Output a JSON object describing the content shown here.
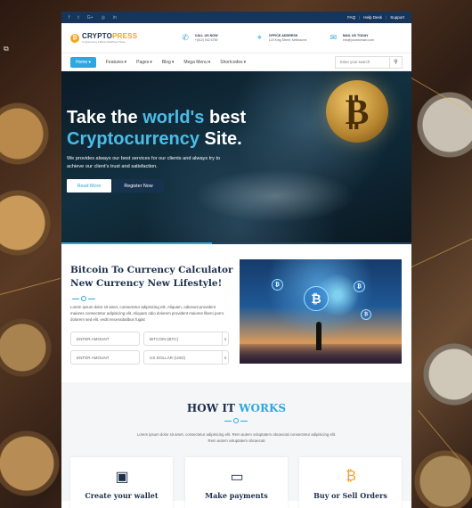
{
  "social": [
    "f",
    "t",
    "G+",
    "◎",
    "in"
  ],
  "toplinks": {
    "faq": "FAQ",
    "help": "Help Desk",
    "support": "Support"
  },
  "logo": {
    "brand_a": "CRYPTO",
    "brand_b": "PRESS",
    "tagline": "Cryptocurrency & Bitcoin WordPress Theme"
  },
  "contacts": [
    {
      "title": "CALL US NOW",
      "value": "+(012) 542 6789",
      "icon": "phone-icon"
    },
    {
      "title": "OFFICE ADDRESS",
      "value": "123 King Street, Melbourne",
      "icon": "map-marker-icon"
    },
    {
      "title": "MAIL US TODAY",
      "value": "info@yourdomain.com",
      "icon": "envelope-icon"
    }
  ],
  "nav": [
    {
      "label": "Home",
      "active": true
    },
    {
      "label": "Features",
      "active": false
    },
    {
      "label": "Pages",
      "active": false
    },
    {
      "label": "Blog",
      "active": false
    },
    {
      "label": "Mega Menu",
      "active": false
    },
    {
      "label": "Shortcodes",
      "active": false
    }
  ],
  "search": {
    "placeholder": "Enter your search"
  },
  "hero": {
    "line1_a": "Take the ",
    "line1_b": "world's",
    "line1_c": " best",
    "line2_a": "Cryptocurrency",
    "line2_b": " Site.",
    "paragraph": "We provides always our best services for our clients and always try to achieve our client's trust and satisfaction.",
    "btn_read": "Read More",
    "btn_register": "Register Now",
    "slide_progress": 0.43
  },
  "calculator": {
    "heading1": "Bitcoin To Currency Calculator",
    "heading2": "New Currency New Lifestyle!",
    "paragraph": "Lorem ipsum dolor sit amet, consectetur adipisicing elit. Aliquam, odiosunt provident maiores consectetur adipisicing elit. Aliquam odio dolorem provident maiores libero porro dolorem sed elit. vedit necessitatibus fugiat",
    "amount_placeholder": "ENTER AMOUNT",
    "currency1": "BITCOIN (BTC)",
    "currency2": "US DOLLAR (USD)"
  },
  "how": {
    "title_a": "HOW IT ",
    "title_b": "WORKS",
    "paragraph": "Lorem ipsum dolor sit amet, consectetur adipisicing elit. Rem autem voluptatem obcaecati consectetur adipisicing elit. Rem autem voluptatem obcaecati",
    "cards": [
      {
        "title": "Create your wallet",
        "icon": "wallet-icon"
      },
      {
        "title": "Make payments",
        "icon": "credit-card-icon"
      },
      {
        "title": "Buy or Sell Orders",
        "icon": "bitcoin-exchange-icon"
      }
    ]
  },
  "colors": {
    "accent": "#2ea7e0",
    "navy": "#1c2f4a",
    "gold": "#f3a51d",
    "topbar": "#16355a"
  }
}
